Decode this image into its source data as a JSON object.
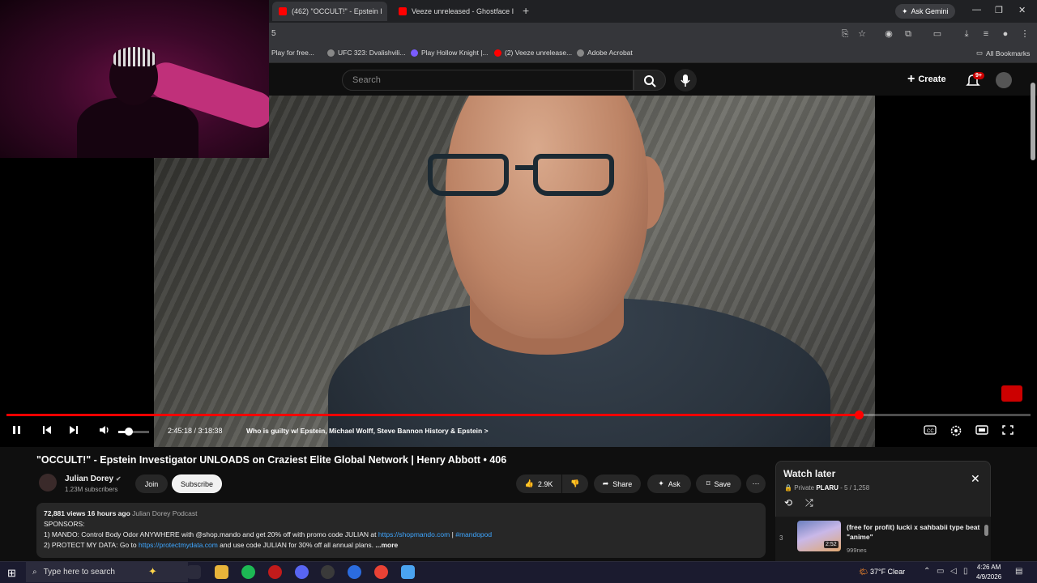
{
  "browser": {
    "tabs": [
      {
        "label": "(462) \"OCCULT!\" - Epstein I",
        "active": true
      },
      {
        "label": "Veeze unreleased - Ghostface I",
        "active": false
      }
    ],
    "ask_gemini": "Ask Gemini",
    "url_fragment": "5",
    "bookmarks": [
      "Play for free...",
      "UFC 323: Dvalishvili...",
      "Play Hollow Knight |...",
      "(2) Veeze unrelease...",
      "Adobe Acrobat"
    ],
    "all_bookmarks": "All Bookmarks"
  },
  "youtube": {
    "search_placeholder": "Search",
    "create_label": "Create",
    "notif_badge": "9+"
  },
  "player": {
    "timecode": "2:45:18 / 3:18:38",
    "chapter": "Who is guilty w/ Epstein, Michael Wolff, Steve Bannon History & Epstein",
    "chapter_chevron": ">",
    "progress": 0.832,
    "volume": 0.35
  },
  "video": {
    "title": "\"OCCULT!\" - Epstein Investigator UNLOADS on Craziest Elite Global Network | Henry Abbott • 406",
    "channel_name": "Julian Dorey",
    "subscribers": "1.23M subscribers",
    "join_label": "Join",
    "subscribe_label": "Subscribe",
    "likes": "2.9K",
    "share_label": "Share",
    "ask_label": "Ask",
    "save_label": "Save"
  },
  "description": {
    "views": "72,881 views",
    "age": "16 hours ago",
    "channel": "Julian Dorey Podcast",
    "sponsors": "SPONSORS:",
    "line1_pre": "1) MANDO: Control Body Odor ANYWHERE with @shop.mando and get 20% off with promo code JULIAN at",
    "line1_link": "https://shopmando.com",
    "line1_sep": "|",
    "line1_tag": "#mandopod",
    "line2_pre": "2) PROTECT MY DATA: Go to",
    "line2_link": "https://protectmydata.com",
    "line2_post": "and use code JULIAN for 30% off all annual plans.",
    "more": "...more"
  },
  "watch_later": {
    "title": "Watch later",
    "privacy": "Private",
    "owner": "PLARU",
    "position": "5 / 1,258",
    "item": {
      "index": "3",
      "title": "(free for profit) lucki x sahbabii type beat \"anime\"",
      "duration": "2:52",
      "channel": "999nes"
    }
  },
  "taskbar": {
    "search_placeholder": "Type here to search",
    "weather": "37°F  Clear",
    "time": "4:26 AM",
    "date": "4/9/2026"
  },
  "colors": {
    "accent": "#ff0000",
    "link": "#3ea6ff"
  }
}
